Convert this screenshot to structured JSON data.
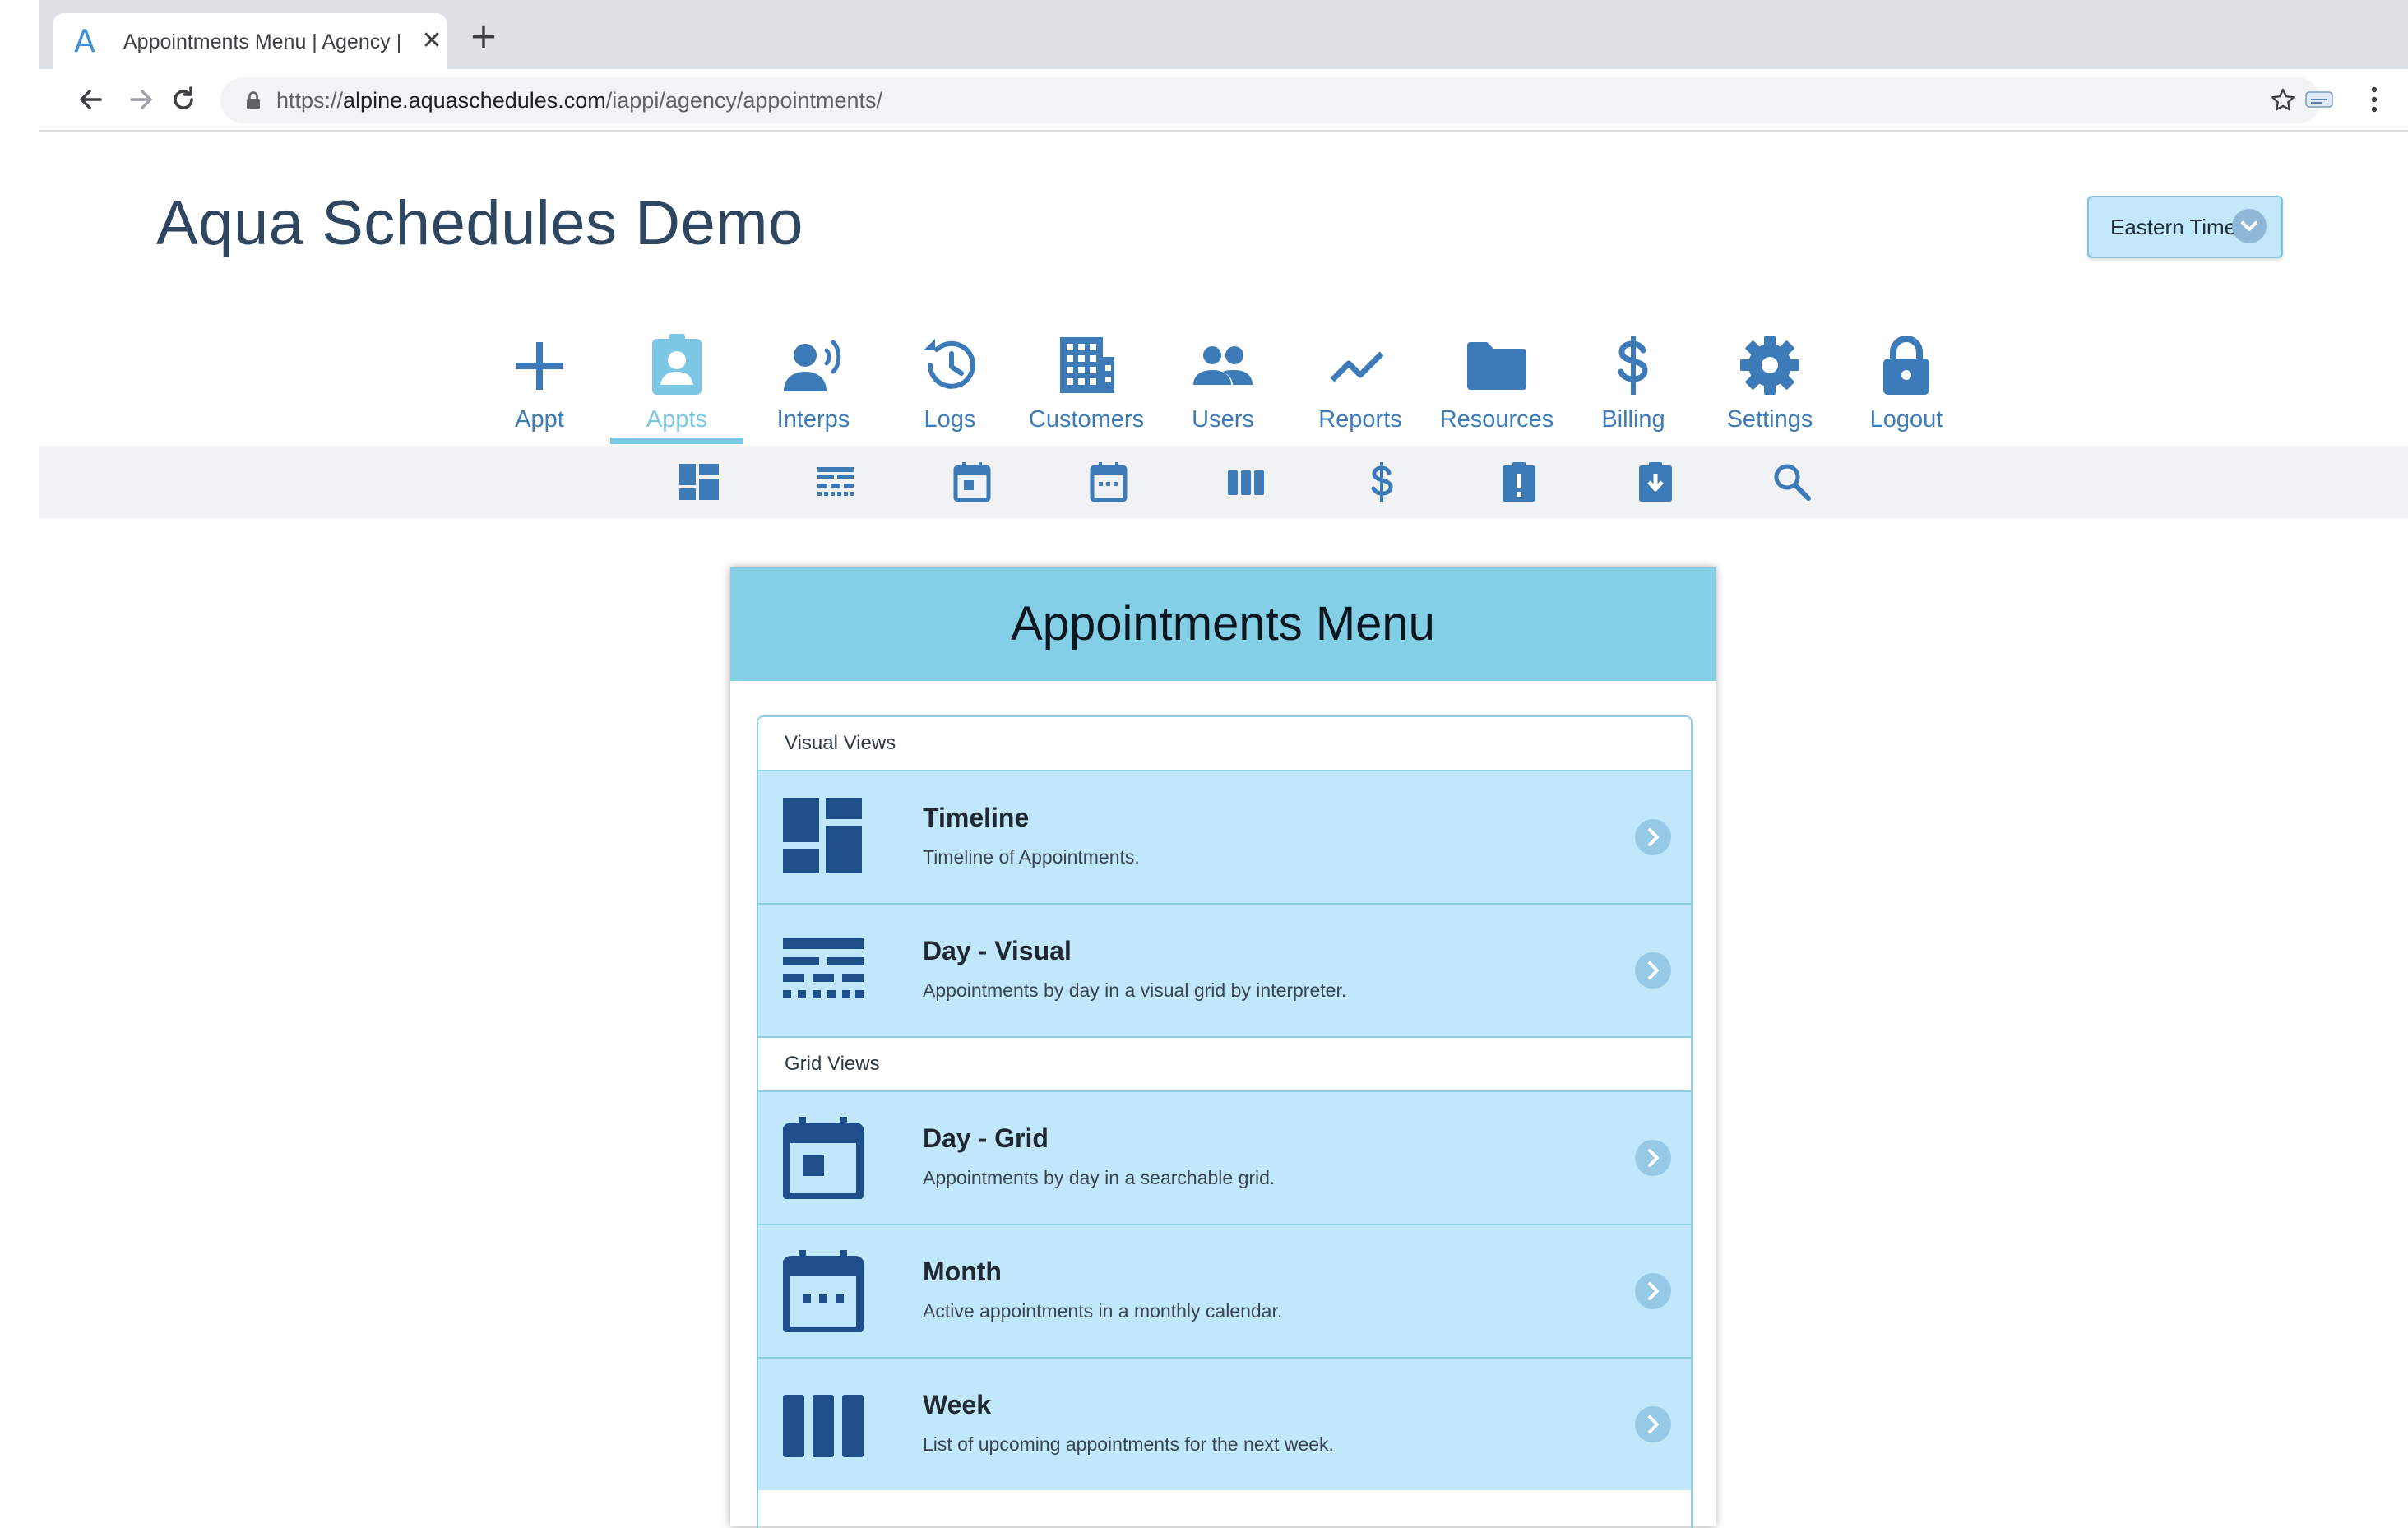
{
  "browser": {
    "tab_title": "Appointments Menu | Agency |",
    "tab_close": "✕",
    "new_tab": "+",
    "url_scheme": "https://",
    "url_host": "alpine.aquaschedules.com",
    "url_path": "/iappi/agency/appointments/"
  },
  "site": {
    "title": "Aqua Schedules Demo",
    "timezone": "Eastern Time"
  },
  "main_nav": [
    {
      "label": "Appt",
      "icon": "plus-icon"
    },
    {
      "label": "Appts",
      "icon": "clipboard-user-icon",
      "active": true
    },
    {
      "label": "Interps",
      "icon": "user-voice-icon"
    },
    {
      "label": "Logs",
      "icon": "history-icon"
    },
    {
      "label": "Customers",
      "icon": "building-icon"
    },
    {
      "label": "Users",
      "icon": "users-icon"
    },
    {
      "label": "Reports",
      "icon": "chart-line-icon"
    },
    {
      "label": "Resources",
      "icon": "folder-icon"
    },
    {
      "label": "Billing",
      "icon": "dollar-icon"
    },
    {
      "label": "Settings",
      "icon": "gear-icon"
    },
    {
      "label": "Logout",
      "icon": "lock-icon"
    }
  ],
  "sub_nav": [
    "dashboard-icon",
    "day-visual-icon",
    "day-grid-icon",
    "month-icon",
    "week-icon",
    "billing-icon",
    "alert-clipboard-icon",
    "download-clipboard-icon",
    "search-icon"
  ],
  "card": {
    "title": "Appointments Menu",
    "sections": {
      "visual": "Visual Views",
      "grid": "Grid Views"
    },
    "rows": [
      {
        "title": "Timeline",
        "desc": "Timeline of Appointments."
      },
      {
        "title": "Day - Visual",
        "desc": "Appointments by day in a visual grid by interpreter."
      },
      {
        "title": "Day - Grid",
        "desc": "Appointments by day in a searchable grid."
      },
      {
        "title": "Month",
        "desc": "Active appointments in a monthly calendar."
      },
      {
        "title": "Week",
        "desc": "List of upcoming appointments for the next week."
      }
    ]
  },
  "colors": {
    "nav_blue": "#3c7ab8",
    "active_aqua": "#7cc8e4",
    "header_aqua": "#82cfe6",
    "row_bg": "#c0e8fa",
    "icon_navy": "#1e4f8c"
  }
}
